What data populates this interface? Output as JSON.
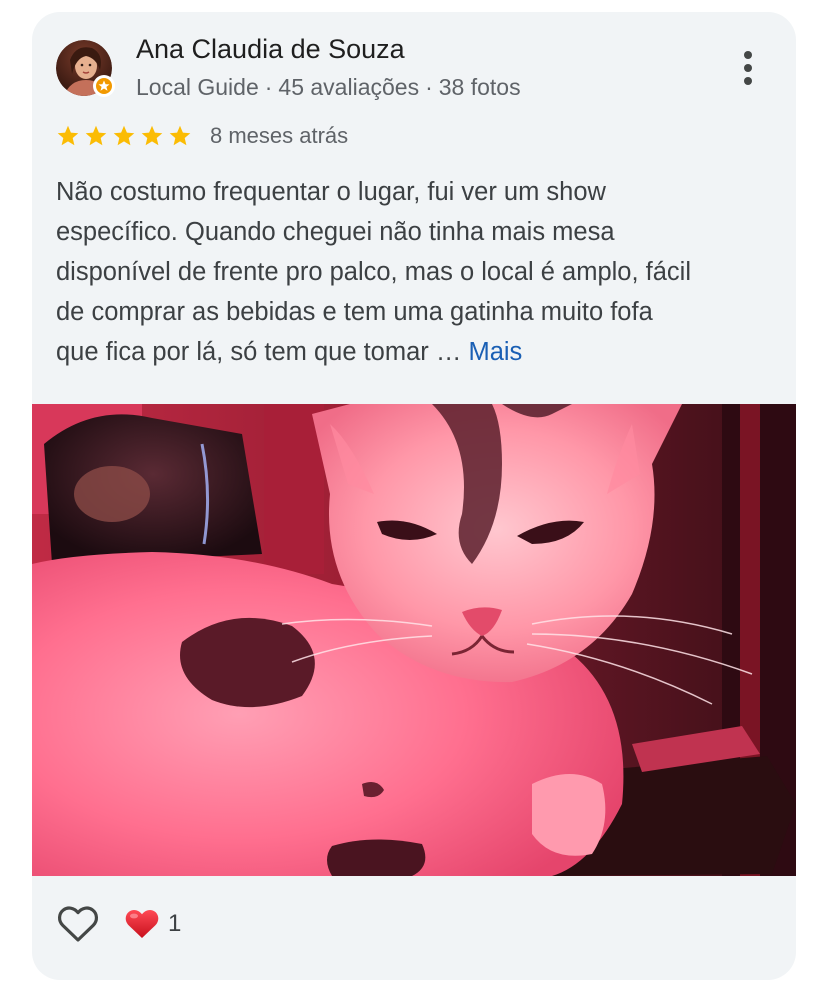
{
  "review": {
    "author": {
      "name": "Ana Claudia de Souza",
      "badge": "Local Guide",
      "reviews": "45 avaliações",
      "photos": "38 fotos",
      "separator": "·",
      "avatar_icon": "user-photo-avatar",
      "badge_icon": "local-guide-badge-icon"
    },
    "rating": 5,
    "max_rating": 5,
    "date": "8 meses atrás",
    "text_lines": [
      "Não costumo frequentar o lugar, fui ver um show",
      "específico. Quando cheguei não tinha mais mesa",
      "disponível de frente pro palco, mas o local é amplo, fácil",
      "de comprar as bebidas e tem uma gatinha muito fofa",
      "que fica por lá, só tem que tomar …"
    ],
    "more_label": "Mais",
    "photo": {
      "icon": "cat-photo",
      "alt": "white cat under red light"
    },
    "actions": {
      "like_icon": "heart-outline-icon",
      "reaction_icon": "red-heart-emoji",
      "reaction_count": "1"
    }
  },
  "colors": {
    "card_background": "#f1f4f6",
    "star": "#fbbc04",
    "link": "#1a5fb4",
    "text_primary": "#1f1f1f",
    "text_secondary": "#5f6368",
    "reaction_heart": "#e0131d"
  }
}
